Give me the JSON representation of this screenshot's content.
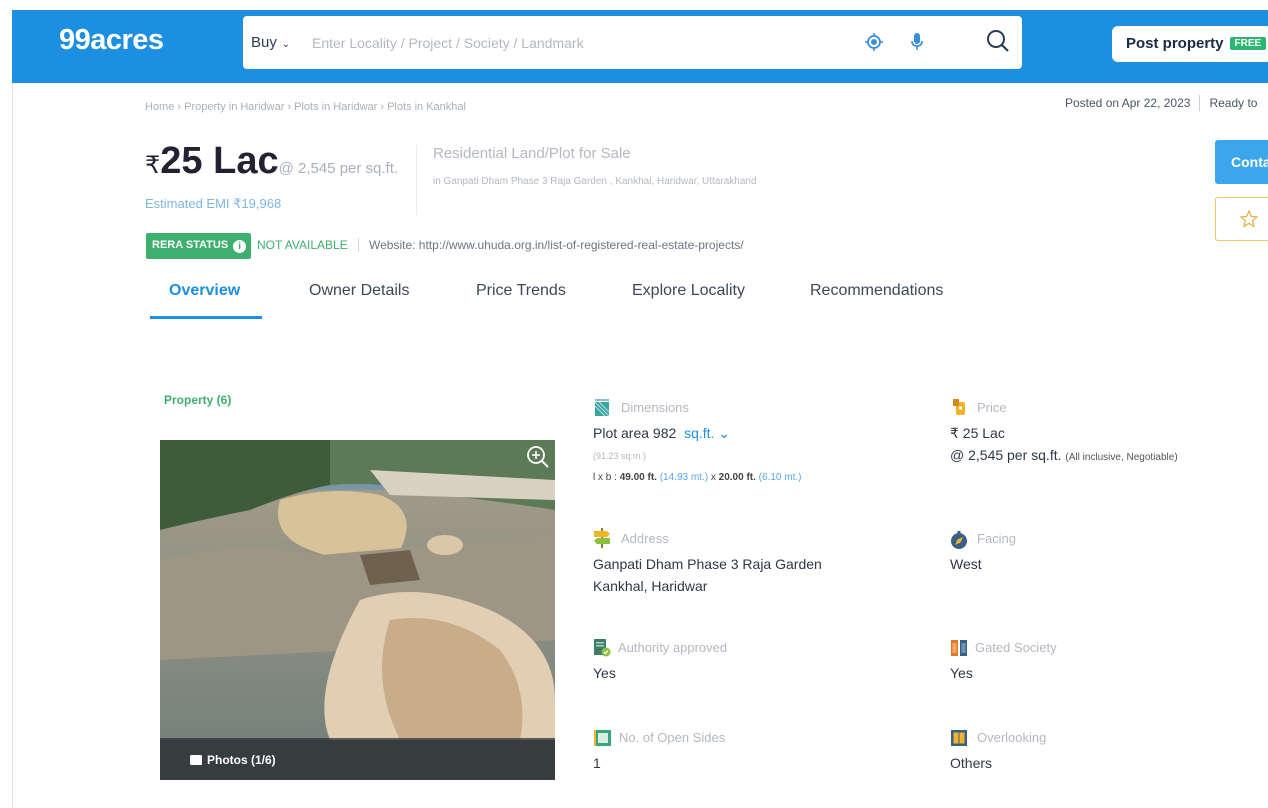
{
  "header": {
    "logo": "99acres",
    "buy_label": "Buy",
    "search_placeholder": "Enter Locality / Project / Society / Landmark",
    "post_property": "Post property",
    "free_badge": "FREE",
    "colors": {
      "brand": "#1d8fe0",
      "free": "#2bb673"
    }
  },
  "breadcrumb": "Home › Property in Haridwar › Plots in Haridwar › Plots in Kankhal",
  "posted": {
    "date": "Posted on Apr 22, 2023",
    "status": "Ready to"
  },
  "listing": {
    "rupee": "₹",
    "price": "25 Lac",
    "per_sqft": "@ 2,545 per sq.ft.",
    "emi": "Estimated EMI ₹19,968",
    "type": "Residential Land/Plot for Sale",
    "address_line": "in Ganpati Dham Phase 3 Raja Garden , Kankhal, Haridwar, Uttarakhand",
    "contact_button": "Contact",
    "rera_badge": "RERA STATUS",
    "rera_status": "NOT AVAILABLE",
    "rera_website": "Website: http://www.uhuda.org.in/list-of-registered-real-estate-projects/"
  },
  "tabs": [
    {
      "label": "Overview"
    },
    {
      "label": "Owner Details"
    },
    {
      "label": "Price Trends"
    },
    {
      "label": "Explore Locality"
    },
    {
      "label": "Recommendations"
    }
  ],
  "gallery": {
    "count_label": "Property (6)",
    "photos_label": "Photos (1/6)"
  },
  "details": {
    "dimensions": {
      "label": "Dimensions",
      "value": "Plot area 982",
      "unit": "sq.ft.",
      "sub": "(91.23 sq.m.)",
      "lxb_prefix": "l x b : ",
      "length_ft": "49.00 ft.",
      "length_m": "(14.93 mt.)",
      "times": " x ",
      "breadth_ft": "20.00 ft.",
      "breadth_m": "(6.10 mt.)"
    },
    "price": {
      "label": "Price",
      "value": "₹ 25 Lac",
      "per_sqft": "@ 2,545 per sq.ft.",
      "note": "(All inclusive, Negotiable)"
    },
    "address": {
      "label": "Address",
      "line1": "Ganpati Dham Phase 3 Raja Garden",
      "line2": "Kankhal, Haridwar"
    },
    "facing": {
      "label": "Facing",
      "value": "West"
    },
    "authority": {
      "label": "Authority approved",
      "value": "Yes"
    },
    "gated": {
      "label": "Gated Society",
      "value": "Yes"
    },
    "open_sides": {
      "label": "No. of Open Sides",
      "value": "1"
    },
    "overlooking": {
      "label": "Overlooking",
      "value": "Others"
    }
  }
}
